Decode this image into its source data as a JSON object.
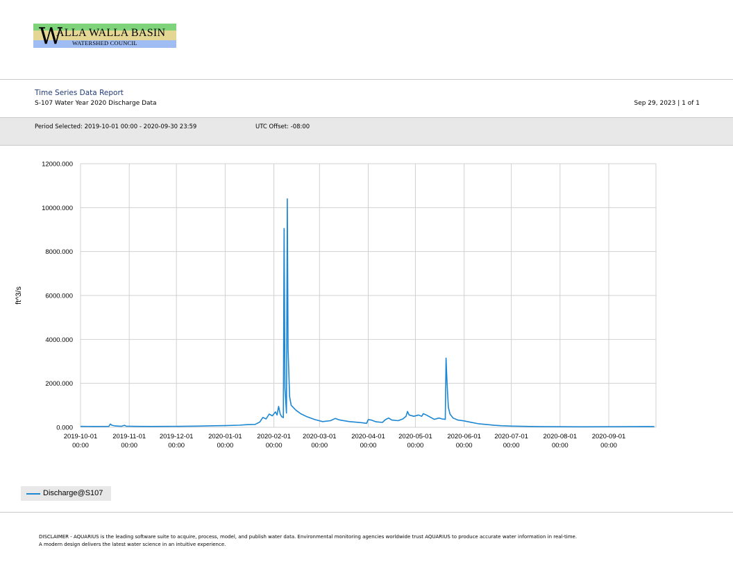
{
  "logo": {
    "initial": "W",
    "title": "ALLA WALLA BASIN",
    "subtitle": "WATERSHED COUNCIL",
    "colors": {
      "top": "#7fd37b",
      "middle": "#e3d793",
      "bottom": "#9fbcf3"
    }
  },
  "report": {
    "title": "Time Series Data Report",
    "subtitle": "S-107 Water Year 2020 Discharge Data",
    "date_page": "Sep 29, 2023 | 1 of 1"
  },
  "period": {
    "selected": "Period Selected: 2019-10-01 00:00 - 2020-09-30 23:59",
    "utc": "UTC Offset: -08:00"
  },
  "chart_data": {
    "type": "line",
    "title": "",
    "xlabel": "",
    "ylabel": "ft^3/s",
    "ylim": [
      0,
      12000
    ],
    "xlim": [
      "2019-10-01",
      "2020-09-30"
    ],
    "yticks": [
      "0.000",
      "2000.000",
      "4000.000",
      "6000.000",
      "8000.000",
      "10000.000",
      "12000.000"
    ],
    "xticks": [
      {
        "date": "2019-10-01",
        "line1": "2019-10-01",
        "line2": "00:00"
      },
      {
        "date": "2019-11-01",
        "line1": "2019-11-01",
        "line2": "00:00"
      },
      {
        "date": "2019-12-01",
        "line1": "2019-12-01",
        "line2": "00:00"
      },
      {
        "date": "2020-01-01",
        "line1": "2020-01-01",
        "line2": "00:00"
      },
      {
        "date": "2020-02-01",
        "line1": "2020-02-01",
        "line2": "00:00"
      },
      {
        "date": "2020-03-01",
        "line1": "2020-03-01",
        "line2": "00:00"
      },
      {
        "date": "2020-04-01",
        "line1": "2020-04-01",
        "line2": "00:00"
      },
      {
        "date": "2020-05-01",
        "line1": "2020-05-01",
        "line2": "00:00"
      },
      {
        "date": "2020-06-01",
        "line1": "2020-06-01",
        "line2": "00:00"
      },
      {
        "date": "2020-07-01",
        "line1": "2020-07-01",
        "line2": "00:00"
      },
      {
        "date": "2020-08-01",
        "line1": "2020-08-01",
        "line2": "00:00"
      },
      {
        "date": "2020-09-01",
        "line1": "2020-09-01",
        "line2": "00:00"
      }
    ],
    "grid": true,
    "legend": "bottom-left",
    "series": [
      {
        "name": "Discharge@S107",
        "color": "#1b86d3",
        "points": [
          [
            "2019-10-01",
            40
          ],
          [
            "2019-10-10",
            38
          ],
          [
            "2019-10-19",
            40
          ],
          [
            "2019-10-20",
            150
          ],
          [
            "2019-10-21",
            90
          ],
          [
            "2019-10-23",
            60
          ],
          [
            "2019-10-27",
            45
          ],
          [
            "2019-10-29",
            90
          ],
          [
            "2019-10-30",
            50
          ],
          [
            "2019-11-05",
            40
          ],
          [
            "2019-11-15",
            38
          ],
          [
            "2019-11-25",
            42
          ],
          [
            "2019-12-05",
            45
          ],
          [
            "2019-12-15",
            55
          ],
          [
            "2019-12-25",
            70
          ],
          [
            "2020-01-01",
            75
          ],
          [
            "2020-01-10",
            95
          ],
          [
            "2020-01-15",
            120
          ],
          [
            "2020-01-20",
            130
          ],
          [
            "2020-01-23",
            240
          ],
          [
            "2020-01-25",
            450
          ],
          [
            "2020-01-27",
            380
          ],
          [
            "2020-01-29",
            600
          ],
          [
            "2020-01-31",
            520
          ],
          [
            "2020-02-02",
            700
          ],
          [
            "2020-02-03",
            560
          ],
          [
            "2020-02-04",
            950
          ],
          [
            "2020-02-05",
            600
          ],
          [
            "2020-02-06",
            480
          ],
          [
            "2020-02-07",
            440
          ],
          [
            "2020-02-07T12",
            9050
          ],
          [
            "2020-02-08",
            1800
          ],
          [
            "2020-02-09",
            650
          ],
          [
            "2020-02-09T12",
            10400
          ],
          [
            "2020-02-10",
            3600
          ],
          [
            "2020-02-11",
            1400
          ],
          [
            "2020-02-12",
            1000
          ],
          [
            "2020-02-15",
            780
          ],
          [
            "2020-02-18",
            620
          ],
          [
            "2020-02-22",
            480
          ],
          [
            "2020-02-27",
            350
          ],
          [
            "2020-03-03",
            260
          ],
          [
            "2020-03-08",
            300
          ],
          [
            "2020-03-11",
            400
          ],
          [
            "2020-03-14",
            330
          ],
          [
            "2020-03-20",
            260
          ],
          [
            "2020-03-28",
            210
          ],
          [
            "2020-03-31",
            180
          ],
          [
            "2020-04-01",
            350
          ],
          [
            "2020-04-03",
            330
          ],
          [
            "2020-04-06",
            250
          ],
          [
            "2020-04-10",
            220
          ],
          [
            "2020-04-12",
            350
          ],
          [
            "2020-04-14",
            420
          ],
          [
            "2020-04-16",
            330
          ],
          [
            "2020-04-20",
            300
          ],
          [
            "2020-04-23",
            380
          ],
          [
            "2020-04-25",
            500
          ],
          [
            "2020-04-26",
            720
          ],
          [
            "2020-04-27",
            560
          ],
          [
            "2020-04-30",
            500
          ],
          [
            "2020-05-03",
            560
          ],
          [
            "2020-05-05",
            500
          ],
          [
            "2020-05-06",
            620
          ],
          [
            "2020-05-08",
            560
          ],
          [
            "2020-05-10",
            480
          ],
          [
            "2020-05-13",
            360
          ],
          [
            "2020-05-16",
            420
          ],
          [
            "2020-05-18",
            380
          ],
          [
            "2020-05-20",
            360
          ],
          [
            "2020-05-20T12",
            3150
          ],
          [
            "2020-05-21",
            2200
          ],
          [
            "2020-05-21T12",
            1500
          ],
          [
            "2020-05-22",
            900
          ],
          [
            "2020-05-23",
            600
          ],
          [
            "2020-05-25",
            420
          ],
          [
            "2020-05-28",
            330
          ],
          [
            "2020-06-01",
            290
          ],
          [
            "2020-06-05",
            230
          ],
          [
            "2020-06-10",
            160
          ],
          [
            "2020-06-15",
            130
          ],
          [
            "2020-06-20",
            90
          ],
          [
            "2020-06-25",
            70
          ],
          [
            "2020-07-01",
            55
          ],
          [
            "2020-07-10",
            40
          ],
          [
            "2020-07-20",
            30
          ],
          [
            "2020-08-01",
            25
          ],
          [
            "2020-08-15",
            22
          ],
          [
            "2020-09-01",
            24
          ],
          [
            "2020-09-15",
            28
          ],
          [
            "2020-09-25",
            35
          ],
          [
            "2020-09-30",
            30
          ]
        ]
      }
    ]
  },
  "legend": {
    "label": "Discharge@S107"
  },
  "disclaimer": "DISCLAIMER - AQUARIUS is the leading software suite to acquire, process, model, and publish water data. Environmental monitoring agencies worldwide trust AQUARIUS to produce accurate water information in real-time. A modern design delivers the latest water science in an intuitive experience."
}
